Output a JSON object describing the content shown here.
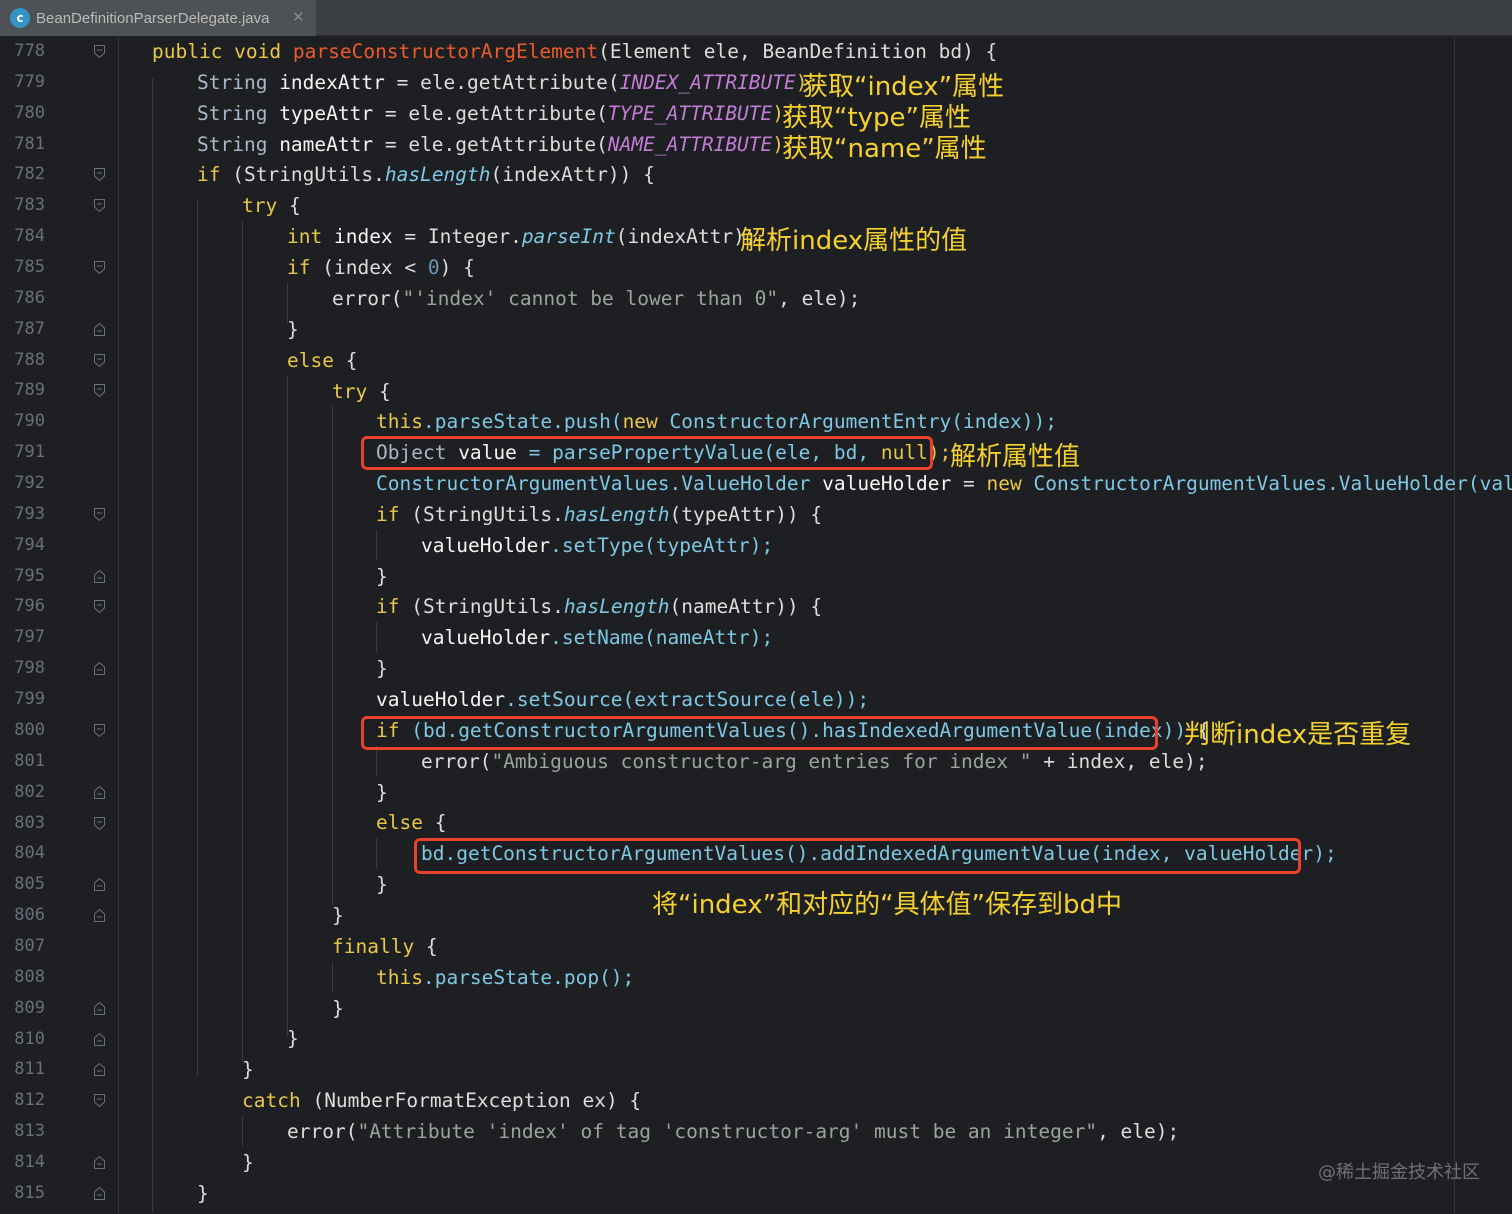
{
  "tab": {
    "title": "BeanDefinitionParserDelegate.java",
    "icon": "c",
    "close": "✕"
  },
  "lines": [
    {
      "n": "778"
    },
    {
      "n": "779"
    },
    {
      "n": "780"
    },
    {
      "n": "781"
    },
    {
      "n": "782"
    },
    {
      "n": "783"
    },
    {
      "n": "784"
    },
    {
      "n": "785"
    },
    {
      "n": "786"
    },
    {
      "n": "787"
    },
    {
      "n": "788"
    },
    {
      "n": "789"
    },
    {
      "n": "790"
    },
    {
      "n": "791"
    },
    {
      "n": "792"
    },
    {
      "n": "793"
    },
    {
      "n": "794"
    },
    {
      "n": "795"
    },
    {
      "n": "796"
    },
    {
      "n": "797"
    },
    {
      "n": "798"
    },
    {
      "n": "799"
    },
    {
      "n": "800"
    },
    {
      "n": "801"
    },
    {
      "n": "802"
    },
    {
      "n": "803"
    },
    {
      "n": "804"
    },
    {
      "n": "805"
    },
    {
      "n": "806"
    },
    {
      "n": "807"
    },
    {
      "n": "808"
    },
    {
      "n": "809"
    },
    {
      "n": "810"
    },
    {
      "n": "811"
    },
    {
      "n": "812"
    },
    {
      "n": "813"
    },
    {
      "n": "814"
    },
    {
      "n": "815"
    }
  ],
  "code": {
    "l778": {
      "a": "public void ",
      "b": "parseConstructorArgElement",
      "c": "(Element ele, BeanDefinition bd) {"
    },
    "l779": {
      "a": "String ",
      "b": "indexAttr",
      "c": " = ele.getAttribute(",
      "d": "INDEX_ATTRIBUTE",
      "e": ");"
    },
    "l780": {
      "a": "String ",
      "b": "typeAttr",
      "c": " = ele.getAttribute(",
      "d": "TYPE_ATTRIBUTE",
      "e": ");"
    },
    "l781": {
      "a": "String ",
      "b": "nameAttr",
      "c": " = ele.getAttribute(",
      "d": "NAME_ATTRIBUTE",
      "e": ");"
    },
    "l782": {
      "a": "if ",
      "b": "(StringUtils.",
      "c": "hasLength",
      "d": "(indexAttr)) {"
    },
    "l783": {
      "a": "try ",
      "b": "{"
    },
    "l784": {
      "a": "int ",
      "b": "index",
      "c": " = Integer.",
      "d": "parseInt",
      "e": "(indexAttr);"
    },
    "l785": {
      "a": "if ",
      "b": "(index < ",
      "c": "0",
      "d": ") {"
    },
    "l786": {
      "a": "error(",
      "b": "\"'index' cannot be lower than 0\"",
      "c": ", ele);"
    },
    "l787": {
      "a": "}"
    },
    "l788": {
      "a": "else ",
      "b": "{"
    },
    "l789": {
      "a": "try ",
      "b": "{"
    },
    "l790": {
      "a": "this",
      "b": ".parseState.push(",
      "c": "new ",
      "d": "ConstructorArgumentEntry(index));"
    },
    "l791": {
      "a": "Object ",
      "b": "value",
      "c": " = parsePropertyValue(ele, bd, ",
      "d": "null",
      "e": ");"
    },
    "l792": {
      "a": "ConstructorArgumentValues.ValueHolder ",
      "b": "valueHolder",
      "c": " = ",
      "d": "new ",
      "e": "ConstructorArgumentValues.ValueHolder(value);"
    },
    "l793": {
      "a": "if ",
      "b": "(StringUtils.",
      "c": "hasLength",
      "d": "(typeAttr)) {"
    },
    "l794": {
      "a": "valueHolder",
      "b": ".setType(typeAttr);"
    },
    "l795": {
      "a": "}"
    },
    "l796": {
      "a": "if ",
      "b": "(StringUtils.",
      "c": "hasLength",
      "d": "(nameAttr)) {"
    },
    "l797": {
      "a": "valueHolder",
      "b": ".setName(nameAttr);"
    },
    "l798": {
      "a": "}"
    },
    "l799": {
      "a": "valueHolder",
      "b": ".setSource(extractSource(ele));"
    },
    "l800": {
      "a": "if ",
      "b": "(bd.getConstructorArgumentValues().hasIndexedArgumentValue(index))",
      "c": " {"
    },
    "l801": {
      "a": "error(",
      "b": "\"Ambiguous constructor-arg entries for index \"",
      "c": " + index, ele);"
    },
    "l802": {
      "a": "}"
    },
    "l803": {
      "a": "else ",
      "b": "{"
    },
    "l804": {
      "a": "bd.getConstructorArgumentValues().addIndexedArgumentValue(index, valueHolder);"
    },
    "l805": {
      "a": "}"
    },
    "l806": {
      "a": "}"
    },
    "l807": {
      "a": "finally ",
      "b": "{"
    },
    "l808": {
      "a": "this",
      "b": ".parseState.pop();"
    },
    "l809": {
      "a": "}"
    },
    "l810": {
      "a": "}"
    },
    "l811": {
      "a": "}"
    },
    "l812": {
      "a": "catch ",
      "b": "(NumberFormatException ex) {"
    },
    "l813": {
      "a": "error(",
      "b": "\"Attribute 'index' of tag 'constructor-arg' must be an integer\"",
      "c": ", ele);"
    },
    "l814": {
      "a": "}"
    },
    "l815": {
      "a": "}"
    }
  },
  "annotations": {
    "a779": "获取“index”属性",
    "a780": "获取“type”属性",
    "a781": "获取“name”属性",
    "a784": "解析index属性的值",
    "a791": "解析属性值",
    "a800": "判断index是否重复",
    "a804": "将“index”和对应的“具体值”保存到bd中"
  },
  "watermark": "@稀土掘金技术社区",
  "colors": {
    "background": "#1e1f22",
    "keyword": "#e8c74a",
    "method_decl": "#ee5a2b",
    "highlight_box": "#e8412c",
    "annotation": "#f5d130"
  }
}
